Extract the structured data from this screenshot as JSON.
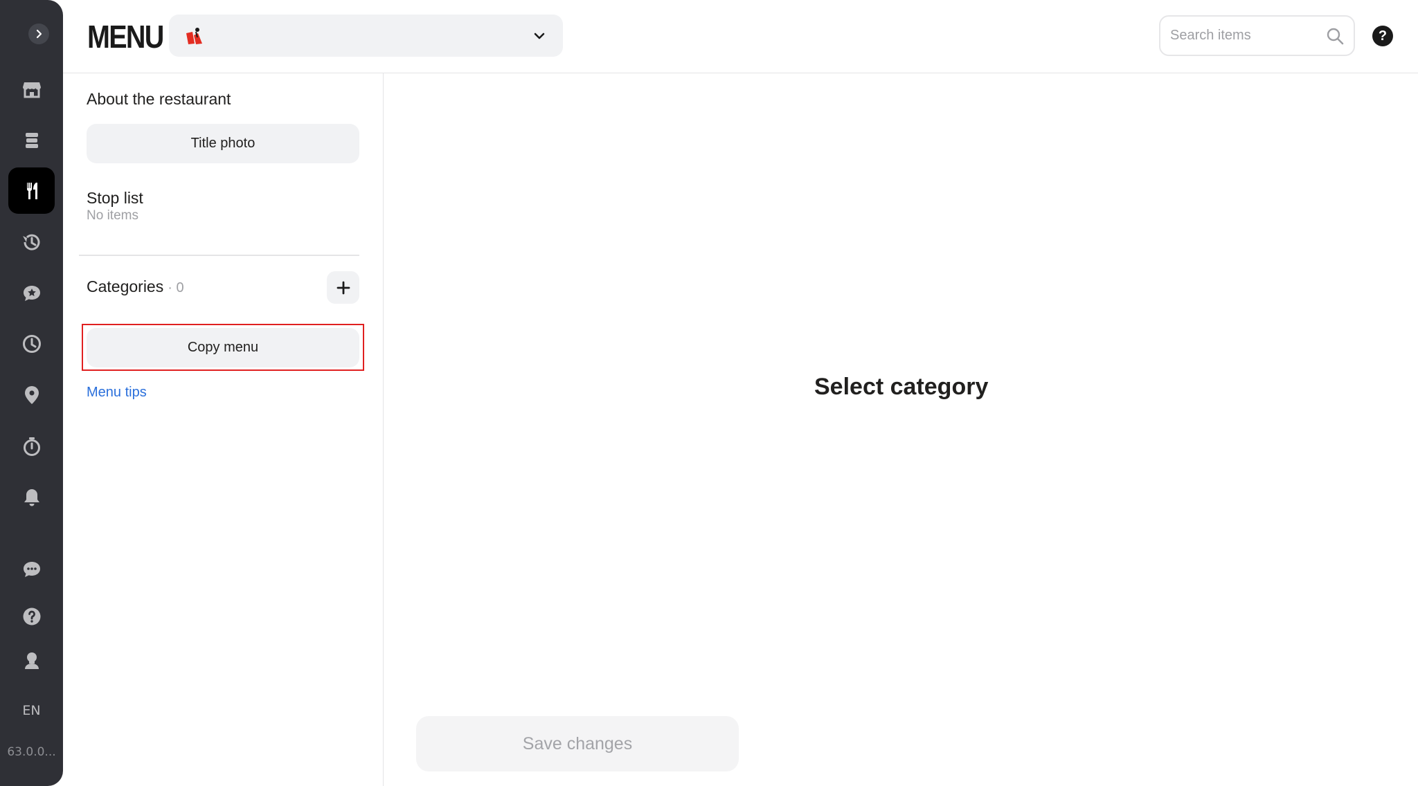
{
  "header": {
    "brand": "MENU",
    "search_placeholder": "Search items",
    "help_label": "?"
  },
  "rail": {
    "items": [
      {
        "icon": "store-icon"
      },
      {
        "icon": "orders-icon"
      },
      {
        "icon": "fork-knife-icon",
        "active": true
      },
      {
        "icon": "history-icon"
      },
      {
        "icon": "reviews-icon"
      },
      {
        "icon": "clock-icon"
      },
      {
        "icon": "location-icon"
      },
      {
        "icon": "timer-icon"
      },
      {
        "icon": "bell-icon"
      },
      {
        "icon": "chat-icon"
      },
      {
        "icon": "help-icon"
      },
      {
        "icon": "support-icon"
      }
    ],
    "language": "EN",
    "version": "63.0.0..."
  },
  "panel": {
    "about_title": "About the restaurant",
    "title_photo_label": "Title photo",
    "stop_list_title": "Stop list",
    "stop_list_sub": "No items",
    "categories_title": "Categories",
    "categories_count": "· 0",
    "copy_menu_label": "Copy menu",
    "menu_tips_label": "Menu tips"
  },
  "main": {
    "empty_title": "Select category",
    "save_label": "Save changes"
  },
  "colors": {
    "rail_bg": "#2f3036",
    "accent_link": "#2a6fdb",
    "highlight": "#e02020",
    "logo_red": "#e32d22"
  }
}
